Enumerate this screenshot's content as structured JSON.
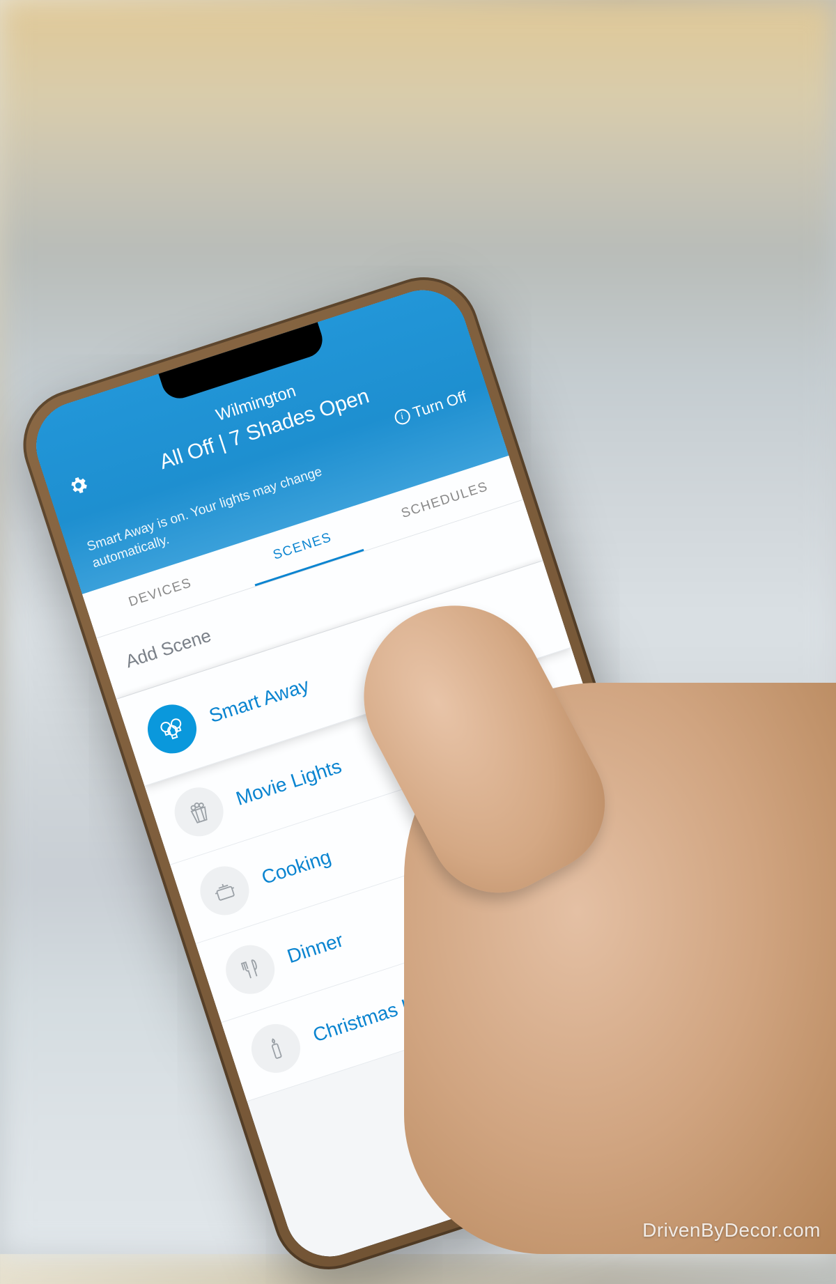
{
  "watermark": "DrivenByDecor.com",
  "header": {
    "home_name": "Wilmington",
    "status": "All Off | 7 Shades Open",
    "turn_off_label": "Turn Off",
    "banner": "Smart Away is on. Your lights may change automatically."
  },
  "tabs": [
    {
      "label": "DEVICES",
      "active": false
    },
    {
      "label": "SCENES",
      "active": true
    },
    {
      "label": "SCHEDULES",
      "active": false
    }
  ],
  "add_scene_label": "Add Scene",
  "scenes": [
    {
      "name": "Smart Away",
      "icon": "bulbs",
      "selected": true
    },
    {
      "name": "Movie Lights",
      "icon": "popcorn",
      "selected": false
    },
    {
      "name": "Cooking",
      "icon": "pot",
      "selected": false
    },
    {
      "name": "Dinner",
      "icon": "utensils",
      "selected": false
    },
    {
      "name": "Christmas Lights",
      "icon": "candle",
      "selected": false
    }
  ]
}
